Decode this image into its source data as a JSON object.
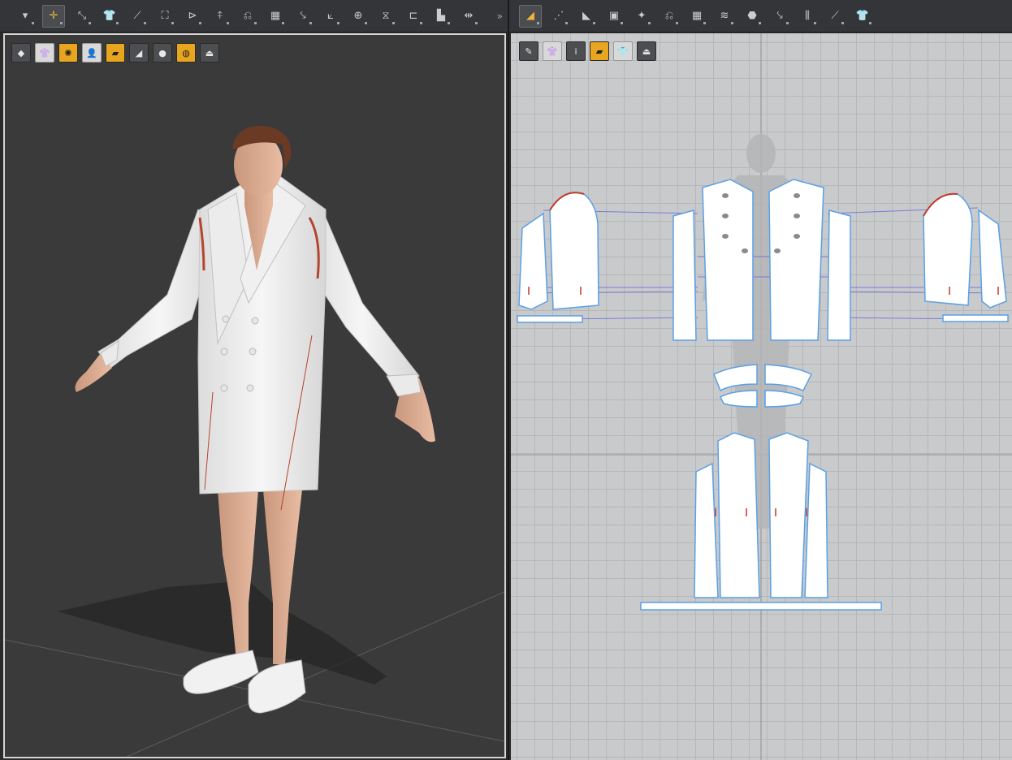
{
  "toolbar_3d": {
    "tools": [
      {
        "name": "simulation-arrow-icon",
        "glyph": "▾",
        "active": false
      },
      {
        "name": "select-move-icon",
        "glyph": "✛",
        "active": true
      },
      {
        "name": "select-mesh-icon",
        "glyph": "⤡",
        "active": false
      },
      {
        "name": "fold-arrangement-icon",
        "glyph": "👕",
        "active": false
      },
      {
        "name": "edit-curvature-icon",
        "glyph": "⟋",
        "active": false
      },
      {
        "name": "arrangement-points-icon",
        "glyph": "⛶",
        "active": false
      },
      {
        "name": "pin-icon",
        "glyph": "⊳",
        "active": false
      },
      {
        "name": "tack-icon",
        "glyph": "⍏",
        "active": false
      },
      {
        "name": "fold-icon",
        "glyph": "⎌",
        "active": false
      },
      {
        "name": "topstitch-icon",
        "glyph": "▦",
        "active": false
      },
      {
        "name": "button-icon",
        "glyph": "⤥",
        "active": false
      },
      {
        "name": "zipper-icon",
        "glyph": "⟀",
        "active": false
      },
      {
        "name": "buttonhole-icon",
        "glyph": "⊕",
        "active": false
      },
      {
        "name": "puckering-icon",
        "glyph": "⧖",
        "active": false
      },
      {
        "name": "measure-icon",
        "glyph": "⊏",
        "active": false
      },
      {
        "name": "trim-icon",
        "glyph": "▙",
        "active": false
      },
      {
        "name": "transform-icon",
        "glyph": "⇹",
        "active": false
      }
    ],
    "expand_glyph": "»"
  },
  "toolbar_2d": {
    "tools": [
      {
        "name": "transform-pattern-icon",
        "glyph": "◢",
        "active": true
      },
      {
        "name": "edit-point-icon",
        "glyph": "⋰",
        "active": false
      },
      {
        "name": "polygon-icon",
        "glyph": "◣",
        "active": false
      },
      {
        "name": "rectangle-icon",
        "glyph": "▣",
        "active": false
      },
      {
        "name": "dart-icon",
        "glyph": "✦",
        "active": false
      },
      {
        "name": "seam-taping-icon",
        "glyph": "⎌",
        "active": false
      },
      {
        "name": "grading-icon",
        "glyph": "▦",
        "active": false
      },
      {
        "name": "pleat-icon",
        "glyph": "≋",
        "active": false
      },
      {
        "name": "button-2d-icon",
        "glyph": "⬣",
        "active": false
      },
      {
        "name": "zipper-2d-icon",
        "glyph": "⤥",
        "active": false
      },
      {
        "name": "segment-sewing-icon",
        "glyph": "⫼",
        "active": false
      },
      {
        "name": "free-sewing-icon",
        "glyph": "⟋",
        "active": false
      },
      {
        "name": "avatar-shirt-icon",
        "glyph": "👕",
        "active": false
      }
    ]
  },
  "viewport_3d_tools": [
    {
      "name": "render-style-icon",
      "glyph": "◆",
      "style": "normal"
    },
    {
      "name": "garment-texture-icon",
      "glyph": "👚",
      "style": "light"
    },
    {
      "name": "strain-map-icon",
      "glyph": "✺",
      "style": "hl"
    },
    {
      "name": "show-avatar-icon",
      "glyph": "👤",
      "style": "light"
    },
    {
      "name": "texture-surface-icon",
      "glyph": "▰",
      "style": "hl"
    },
    {
      "name": "thickness-icon",
      "glyph": "◢",
      "style": "normal"
    },
    {
      "name": "skin-icon",
      "glyph": "●",
      "style": "normal"
    },
    {
      "name": "environment-globe-icon",
      "glyph": "◍",
      "style": "hl"
    },
    {
      "name": "export-icon",
      "glyph": "⏏",
      "style": "normal"
    }
  ],
  "viewport_2d_tools": [
    {
      "name": "pattern-brush-icon",
      "glyph": "✎",
      "style": "normal"
    },
    {
      "name": "texture-2d-icon",
      "glyph": "👚",
      "style": "light"
    },
    {
      "name": "info-icon",
      "glyph": "i",
      "style": "normal"
    },
    {
      "name": "fabric-2d-icon",
      "glyph": "▰",
      "style": "hl"
    },
    {
      "name": "lock-shirt-icon",
      "glyph": "👕",
      "style": "light"
    },
    {
      "name": "export-2d-icon",
      "glyph": "⏏",
      "style": "normal"
    }
  ],
  "colors": {
    "toolbar_bg": "#333538",
    "active_accent": "#f2b43a",
    "viewport3d_bg": "#3a3a3b",
    "viewport2d_bg": "#c9cacb",
    "pattern_outline": "#5aa0e6",
    "sewing_line": "#6a6ad0",
    "piping_red": "#b5442e"
  }
}
